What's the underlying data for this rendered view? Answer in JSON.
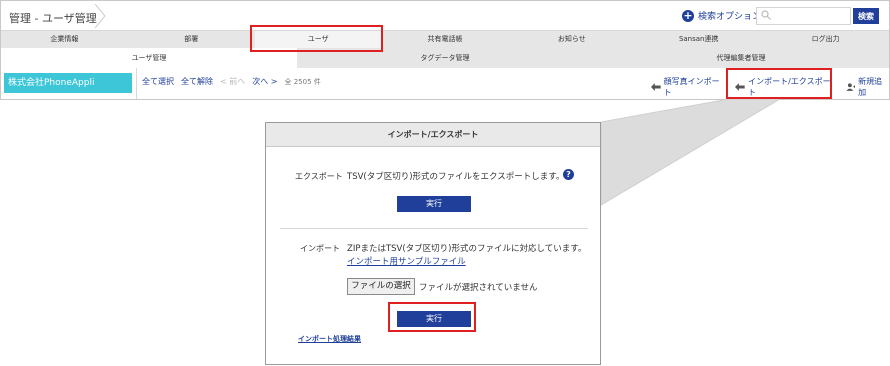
{
  "header": {
    "breadcrumb": "管理 - ユーザ管理",
    "search_option": "検索オプション",
    "search_placeholder": "",
    "search_button": "検索"
  },
  "main_tabs": [
    "企業情報",
    "部署",
    "ユーザ",
    "共有電話帳",
    "お知らせ",
    "Sansan連携",
    "ログ出力"
  ],
  "sub_tabs": [
    "ユーザ管理",
    "タグデータ管理",
    "代理編集者管理"
  ],
  "sidebar": {
    "company": "株式会社PhoneAppli"
  },
  "toolbar": {
    "select_all": "全て選択",
    "deselect_all": "全て解除",
    "prev": "< 前へ",
    "next": "次へ >",
    "count": "全 2505 件"
  },
  "actions": {
    "face_photo_import": "顔写真インポート",
    "import_export": "インポート/エクスポート",
    "add_new": "新規追加"
  },
  "dialog": {
    "title": "インポート/エクスポート",
    "export_label": "エクスポート",
    "export_text": "TSV(タブ区切り)形式のファイルをエクスポートします。",
    "export_run": "実行",
    "import_label": "インポート",
    "import_text": "ZIPまたはTSV(タブ区切り)形式のファイルに対応しています。",
    "import_sample_link": "インポート用サンプルファイル",
    "file_choose": "ファイルの選択",
    "file_status": "ファイルが選択されていません",
    "import_run": "実行",
    "result_link": "インポート処理結果"
  },
  "colors": {
    "accent": "#1f3f9a",
    "company_bg": "#3cc6d8",
    "highlight": "#e02020"
  }
}
